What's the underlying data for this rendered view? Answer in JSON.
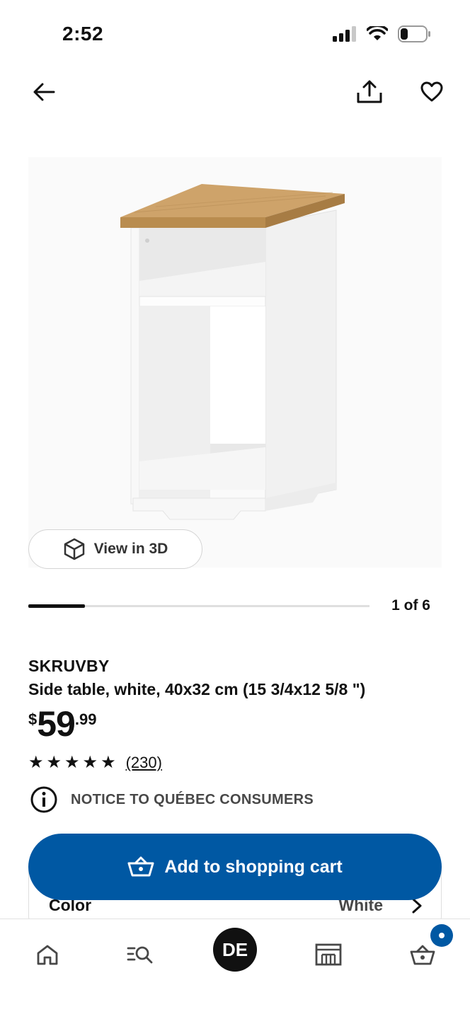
{
  "status": {
    "time": "2:52"
  },
  "product": {
    "name": "SKRUVBY",
    "description": "Side table, white, 40x32 cm (15 3/4x12 5/8 \")",
    "price": {
      "currency": "$",
      "main": "59",
      "cents": ".99"
    },
    "rating": {
      "stars": 5,
      "count": "(230)"
    },
    "notice": "NOTICE TO QUÉBEC CONSUMERS"
  },
  "gallery": {
    "view3d_label": "View in 3D",
    "counter": "1 of 6",
    "progress": 0.167
  },
  "cart": {
    "button_label": "Add to shopping cart"
  },
  "option": {
    "label": "Color",
    "value": "White"
  },
  "bottom_nav": {
    "profile_initials": "DE"
  },
  "colors": {
    "accent": "#0058a3",
    "wood": "#c49a5e",
    "text": "#111111"
  },
  "icons": [
    "back-arrow-icon",
    "share-icon",
    "heart-icon",
    "cube-3d-icon",
    "info-icon",
    "basket-icon",
    "chevron-right-icon",
    "home-icon",
    "search-list-icon",
    "store-icon",
    "cart-icon"
  ]
}
